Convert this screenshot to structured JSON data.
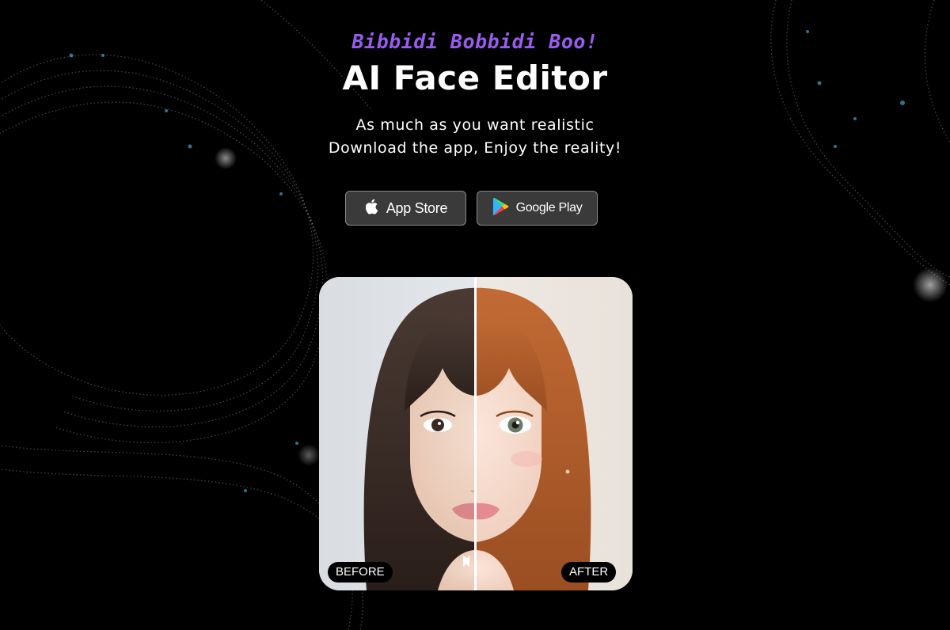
{
  "hero": {
    "tagline": "Bibbidi Bobbidi Boo!",
    "title": "AI Face Editor",
    "subtitle_line1": "As much as you want realistic",
    "subtitle_line2": "Download the app, Enjoy the reality!"
  },
  "store_buttons": {
    "app_store": {
      "label": "App Store",
      "icon": "apple-icon"
    },
    "google_play": {
      "label": "Google Play",
      "icon": "google-play-icon"
    }
  },
  "comparison": {
    "before_label": "BEFORE",
    "after_label": "AFTER",
    "slider_position": 0.5
  },
  "colors": {
    "background": "#000000",
    "tagline": "#9a5cf0",
    "button_bg": "#3a3a3a",
    "button_border": "#8a8a8a",
    "after_hair": "#b05a2a",
    "before_hair": "#3a2a24"
  }
}
